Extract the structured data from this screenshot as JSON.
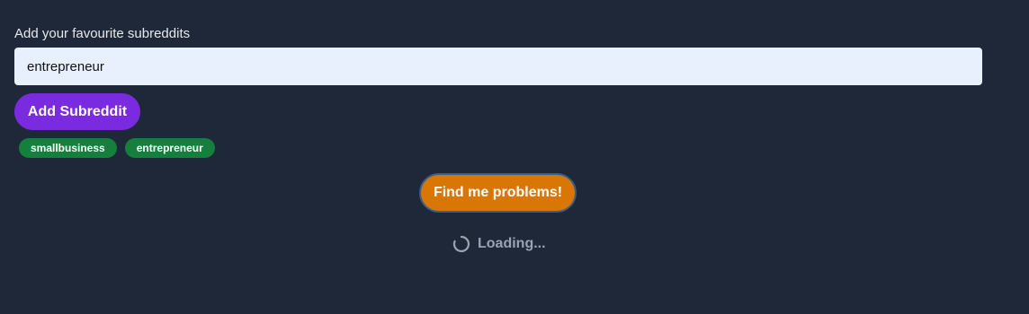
{
  "form": {
    "label": "Add your favourite subreddits",
    "input_value": "entrepreneur",
    "add_button_label": "Add Subreddit"
  },
  "tags": [
    "smallbusiness",
    "entrepreneur"
  ],
  "find_button_label": "Find me problems!",
  "loading": {
    "text": "Loading...",
    "icon": "spinner-icon"
  },
  "colors": {
    "background": "#1f2838",
    "input_bg": "#e8f0fe",
    "add_button": "#7a2be0",
    "tag": "#15803d",
    "find_button": "#d97706",
    "loading_text": "#9ca3af"
  }
}
